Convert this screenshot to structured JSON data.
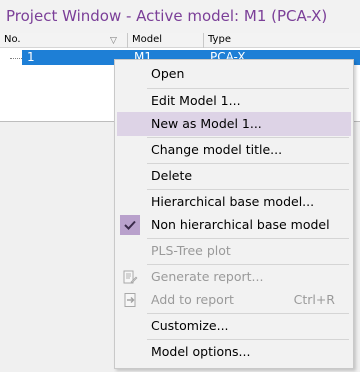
{
  "window": {
    "title": "Project Window - Active model: M1 (PCA-X)"
  },
  "grid": {
    "columns": {
      "no": "No.",
      "model": "Model",
      "type": "Type"
    },
    "rows": [
      {
        "no": "1",
        "model": "M1",
        "type": "PCA-X"
      }
    ]
  },
  "context_menu": {
    "items": [
      {
        "label": "Open",
        "shortcut": "",
        "enabled": true,
        "icon": ""
      },
      {
        "label": "Edit Model 1...",
        "shortcut": "",
        "enabled": true,
        "icon": ""
      },
      {
        "label": "New as Model 1...",
        "shortcut": "",
        "enabled": true,
        "icon": "",
        "highlighted": true
      },
      {
        "label": "Change model title...",
        "shortcut": "",
        "enabled": true,
        "icon": ""
      },
      {
        "label": "Delete",
        "shortcut": "",
        "enabled": true,
        "icon": ""
      },
      {
        "label": "Hierarchical base model...",
        "shortcut": "",
        "enabled": true,
        "icon": ""
      },
      {
        "label": "Non hierarchical base model",
        "shortcut": "",
        "enabled": true,
        "icon": "checkmark-icon",
        "checked": true
      },
      {
        "label": "PLS-Tree plot",
        "shortcut": "",
        "enabled": false,
        "icon": ""
      },
      {
        "label": "Generate report...",
        "shortcut": "",
        "enabled": false,
        "icon": "generate-report-icon"
      },
      {
        "label": "Add to report",
        "shortcut": "Ctrl+R",
        "enabled": false,
        "icon": "add-to-report-icon"
      },
      {
        "label": "Customize...",
        "shortcut": "",
        "enabled": true,
        "icon": ""
      },
      {
        "label": "Model options...",
        "shortcut": "",
        "enabled": true,
        "icon": ""
      }
    ]
  },
  "colors": {
    "title_text": "#7b3f98",
    "selection": "#1e7fd6",
    "menu_highlight": "#ddd3e6",
    "check_background": "#b9a1cc"
  }
}
